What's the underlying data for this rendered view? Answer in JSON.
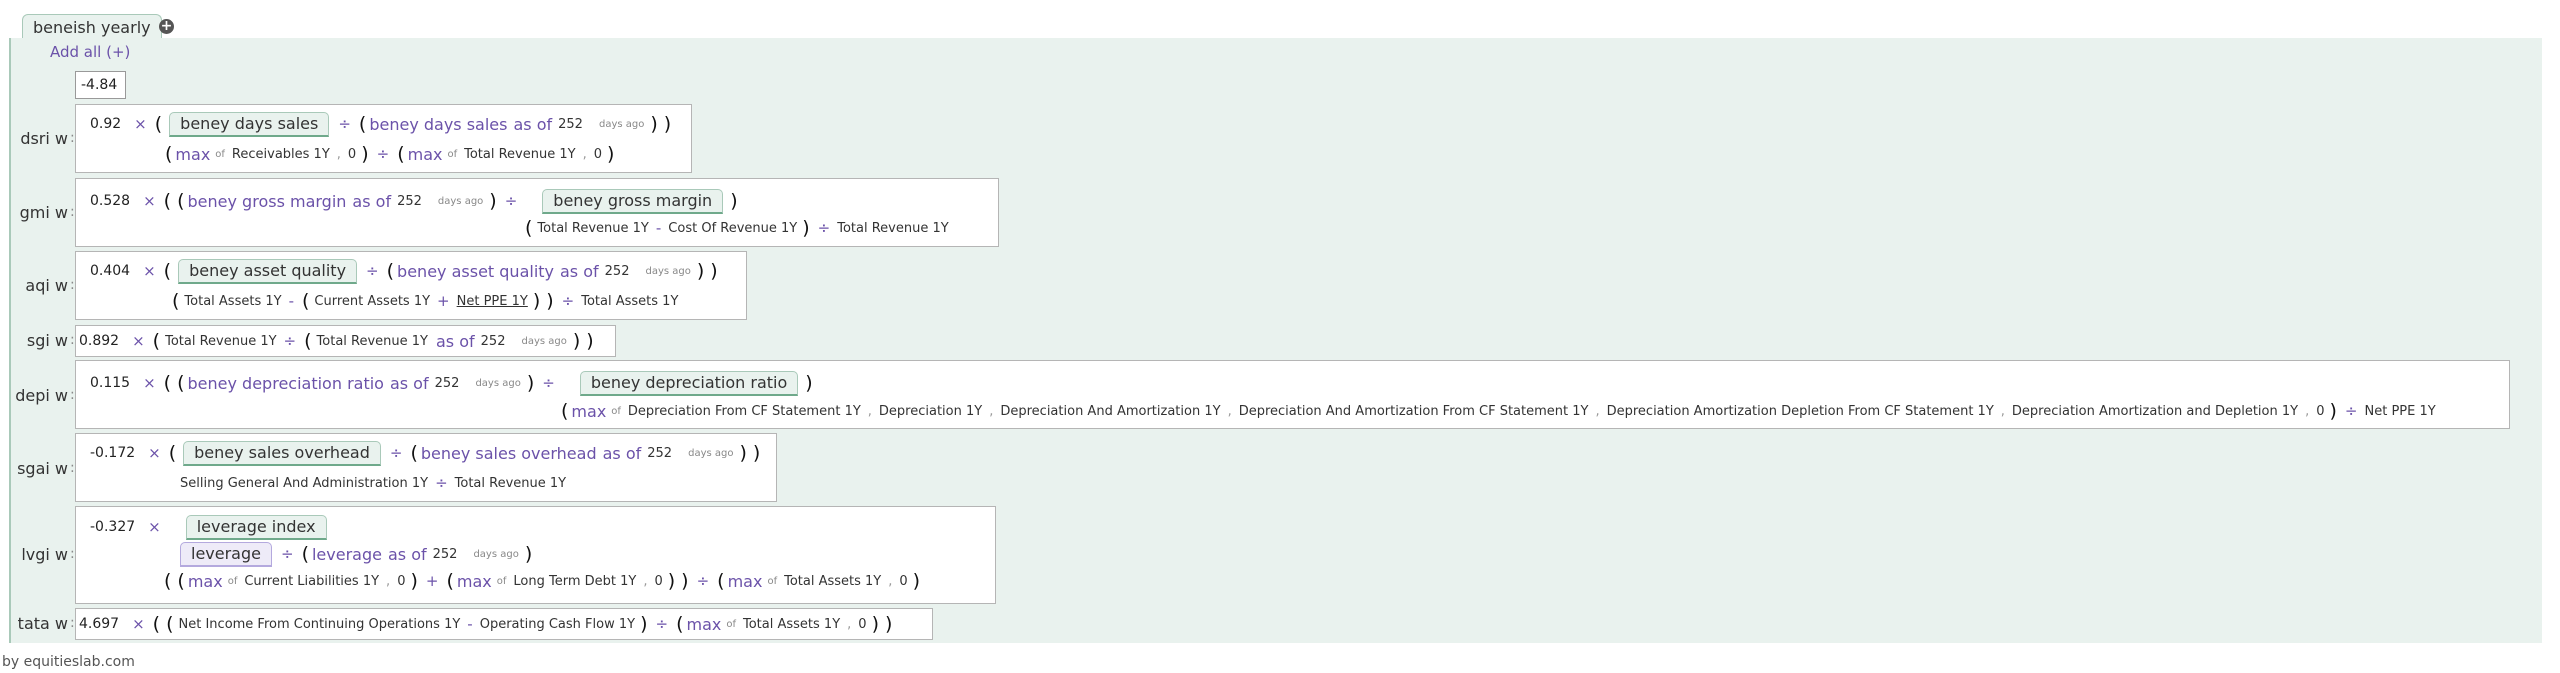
{
  "tab": {
    "label": "beneish yearly"
  },
  "add_all": "Add all (+)",
  "result": "-4.84",
  "footer": "by equitieslab.com",
  "times": "×",
  "div": "÷",
  "minus": "-",
  "plus": "+",
  "lp": "(",
  "rp": ")",
  "comma": ",",
  "max": "max",
  "of": "of",
  "as_of": "as of",
  "days_ago": "days ago",
  "days": "252",
  "zero": "0",
  "rows": [
    {
      "label": "dsri w",
      "coef": "0.92",
      "chip": "beney days sales",
      "hist": "beney days sales",
      "terms": [
        "Receivables 1Y",
        "Total Revenue 1Y"
      ]
    },
    {
      "label": "gmi w",
      "coef": "0.528",
      "chip": "beney gross margin",
      "hist": "beney gross margin",
      "terms": [
        "Total Revenue 1Y",
        "Cost Of Revenue 1Y",
        "Total Revenue 1Y"
      ]
    },
    {
      "label": "aqi w",
      "coef": "0.404",
      "chip": "beney asset quality",
      "hist": "beney asset quality",
      "terms": [
        "Total Assets 1Y",
        "Current Assets 1Y",
        "Net PPE 1Y",
        "Total Assets 1Y"
      ]
    },
    {
      "label": "sgi w",
      "coef": "0.892",
      "terms": [
        "Total Revenue 1Y",
        "Total Revenue 1Y"
      ]
    },
    {
      "label": "depi w",
      "coef": "0.115",
      "chip": "beney depreciation ratio",
      "hist": "beney depreciation ratio",
      "terms": [
        "Depreciation From CF Statement 1Y",
        "Depreciation 1Y",
        "Depreciation And Amortization 1Y",
        "Depreciation And Amortization From CF Statement 1Y",
        "Depreciation Amortization Depletion From CF Statement 1Y",
        "Depreciation Amortization and Depletion 1Y",
        "Net PPE 1Y"
      ]
    },
    {
      "label": "sgai w",
      "coef": "-0.172",
      "chip": "beney sales overhead",
      "hist": "beney sales overhead",
      "terms": [
        "Selling General And Administration 1Y",
        "Total Revenue 1Y"
      ]
    },
    {
      "label": "lvgi w",
      "coef": "-0.327",
      "chip": "leverage index",
      "chip2": "leverage",
      "hist": "leverage",
      "terms": [
        "Current Liabilities 1Y",
        "Long Term Debt 1Y",
        "Total Assets 1Y"
      ]
    },
    {
      "label": "tata w",
      "coef": "4.697",
      "terms": [
        "Net Income From Continuing Operations 1Y",
        "Operating Cash Flow 1Y",
        "Total Assets 1Y"
      ]
    }
  ]
}
